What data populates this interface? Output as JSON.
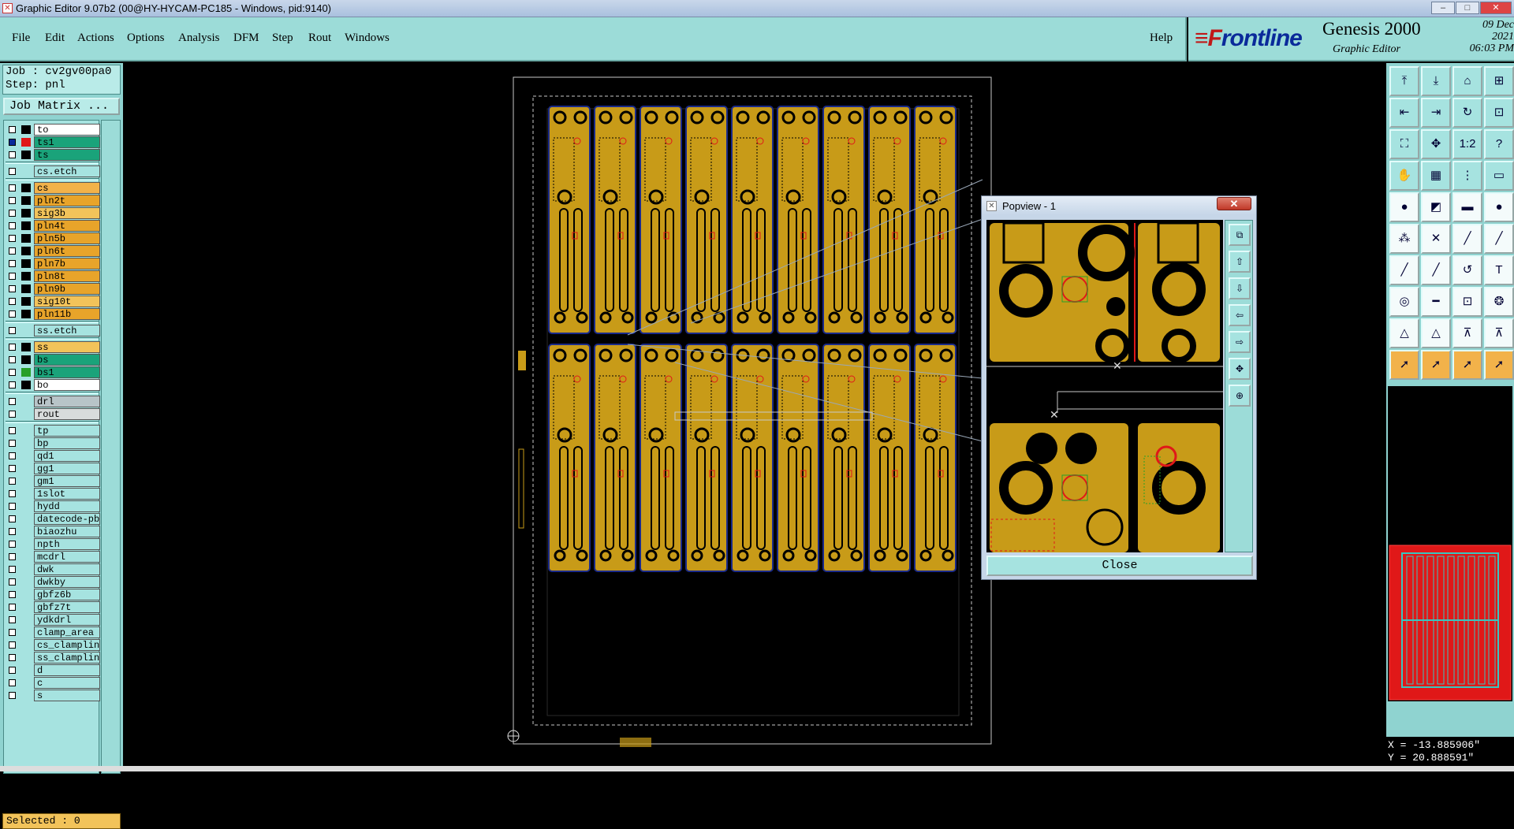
{
  "window": {
    "title": "Graphic Editor 9.07b2 (00@HY-HYCAM-PC185 - Windows, pid:9140)",
    "app_icon_glyph": "✕",
    "minimize": "–",
    "maximize": "□",
    "close": "✕"
  },
  "menu": {
    "items": [
      "File",
      "Edit",
      "Actions",
      "Options",
      "Analysis",
      "DFM",
      "Step",
      "Rout",
      "Windows"
    ],
    "help": "Help"
  },
  "brand": {
    "logo_mark": "≡F",
    "logo_text": "rontline",
    "product": "Genesis 2000",
    "subtitle": "Graphic Editor",
    "date": "09  Dec  2021",
    "time": "06:03  PM"
  },
  "job": {
    "job_label": "Job : cv2gv00pa0",
    "step_label": "Step: pnl",
    "job_matrix_button": "Job Matrix ..."
  },
  "layers": [
    {
      "name": "to",
      "color": "#ffffff",
      "swatch": "#000000",
      "active": false
    },
    {
      "name": "ts1",
      "color": "#1aa37a",
      "swatch": "#e01818",
      "active": true
    },
    {
      "name": "ts",
      "color": "#1aa37a",
      "swatch": "#000000",
      "active": false
    },
    {
      "name": "cs.etch",
      "color": "#a6e3e0",
      "swatch": "",
      "active": false,
      "group_start": true
    },
    {
      "name": "cs",
      "color": "#f2b24a",
      "swatch": "#000000",
      "active": false,
      "group_start": true
    },
    {
      "name": "pln2t",
      "color": "#e8a42a",
      "swatch": "#000000",
      "active": false
    },
    {
      "name": "sig3b",
      "color": "#f2c35a",
      "swatch": "#000000",
      "active": false
    },
    {
      "name": "pln4t",
      "color": "#e8a42a",
      "swatch": "#000000",
      "active": false
    },
    {
      "name": "pln5b",
      "color": "#e8a42a",
      "swatch": "#000000",
      "active": false
    },
    {
      "name": "pln6t",
      "color": "#e8a42a",
      "swatch": "#000000",
      "active": false
    },
    {
      "name": "pln7b",
      "color": "#e8a42a",
      "swatch": "#000000",
      "active": false
    },
    {
      "name": "pln8t",
      "color": "#e8a42a",
      "swatch": "#000000",
      "active": false
    },
    {
      "name": "pln9b",
      "color": "#e8a42a",
      "swatch": "#000000",
      "active": false
    },
    {
      "name": "sig10t",
      "color": "#f2c35a",
      "swatch": "#000000",
      "active": false
    },
    {
      "name": "pln11b",
      "color": "#e8a42a",
      "swatch": "#000000",
      "active": false
    },
    {
      "name": "ss.etch",
      "color": "#a6e3e0",
      "swatch": "",
      "active": false,
      "group_start": true
    },
    {
      "name": "ss",
      "color": "#f2c35a",
      "swatch": "#000000",
      "active": false,
      "group_start": true
    },
    {
      "name": "bs",
      "color": "#1aa37a",
      "swatch": "#000000",
      "active": false
    },
    {
      "name": "bs1",
      "color": "#1aa37a",
      "swatch": "#28a028",
      "active": false
    },
    {
      "name": "bo",
      "color": "#ffffff",
      "swatch": "#000000",
      "active": false
    },
    {
      "name": "drl",
      "color": "#b8c4c8",
      "swatch": "",
      "active": false,
      "group_start": true
    },
    {
      "name": "rout",
      "color": "#d8dcdc",
      "swatch": "",
      "active": false
    },
    {
      "name": "tp",
      "color": "#a6e3e0",
      "swatch": "",
      "active": false,
      "group_start": true
    },
    {
      "name": "bp",
      "color": "#a6e3e0",
      "swatch": "",
      "active": false
    },
    {
      "name": "qd1",
      "color": "#a6e3e0",
      "swatch": "",
      "active": false
    },
    {
      "name": "gg1",
      "color": "#a6e3e0",
      "swatch": "",
      "active": false
    },
    {
      "name": "gm1",
      "color": "#a6e3e0",
      "swatch": "",
      "active": false
    },
    {
      "name": "1slot",
      "color": "#a6e3e0",
      "swatch": "",
      "active": false
    },
    {
      "name": "hydd",
      "color": "#a6e3e0",
      "swatch": "",
      "active": false
    },
    {
      "name": "datecode-pbc",
      "color": "#a6e3e0",
      "swatch": "",
      "active": false
    },
    {
      "name": "biaozhu",
      "color": "#a6e3e0",
      "swatch": "",
      "active": false
    },
    {
      "name": "npth",
      "color": "#a6e3e0",
      "swatch": "",
      "active": false
    },
    {
      "name": "mcdrl",
      "color": "#a6e3e0",
      "swatch": "",
      "active": false
    },
    {
      "name": "dwk",
      "color": "#a6e3e0",
      "swatch": "",
      "active": false
    },
    {
      "name": "dwkby",
      "color": "#a6e3e0",
      "swatch": "",
      "active": false
    },
    {
      "name": "gbfz6b",
      "color": "#a6e3e0",
      "swatch": "",
      "active": false
    },
    {
      "name": "gbfz7t",
      "color": "#a6e3e0",
      "swatch": "",
      "active": false
    },
    {
      "name": "ydkdrl",
      "color": "#a6e3e0",
      "swatch": "",
      "active": false
    },
    {
      "name": "clamp_area",
      "color": "#a6e3e0",
      "swatch": "",
      "active": false
    },
    {
      "name": "cs_clampline",
      "color": "#a6e3e0",
      "swatch": "",
      "active": false
    },
    {
      "name": "ss_clampline",
      "color": "#a6e3e0",
      "swatch": "",
      "active": false
    },
    {
      "name": "d",
      "color": "#a6e3e0",
      "swatch": "",
      "active": false
    },
    {
      "name": "c",
      "color": "#a6e3e0",
      "swatch": "",
      "active": false
    },
    {
      "name": "s",
      "color": "#a6e3e0",
      "swatch": "",
      "active": false
    }
  ],
  "status": {
    "selected": "Selected : 0"
  },
  "popview": {
    "title": "Popview - 1",
    "close_glyph": "✕",
    "close_button": "Close",
    "tool_icons": [
      "zoom-window-icon",
      "zoom-in-icon",
      "zoom-out-icon",
      "pan-left-icon",
      "pan-right-icon",
      "fit-icon",
      "center-icon"
    ]
  },
  "toolbox": {
    "icons": [
      "home-up-icon",
      "home-down-icon",
      "home-icon",
      "grid-icon",
      "pan-left-icon",
      "pan-right-icon",
      "redraw-icon",
      "snap-icon",
      "zoom-fit-icon",
      "zoom-center-icon",
      "ratio-icon",
      "help-icon",
      "hand-icon",
      "layer-grid-icon",
      "align-icon",
      "measure-icon",
      "pad-icon",
      "profile-icon",
      "ruler-icon",
      "dot-icon",
      "select-net-icon",
      "cross-icon",
      "line-red-icon",
      "line-blue-icon",
      "line-draw-icon",
      "line-cut-icon",
      "arc-icon",
      "text-icon",
      "pad-add-icon",
      "line-add-icon",
      "region-icon",
      "circles-icon",
      "triangle-a-icon",
      "triangle-b-icon",
      "shape-c-icon",
      "shape-d-icon",
      "pointer-icon",
      "pointer-select-icon",
      "pointer-move-icon",
      "pointer-edit-icon"
    ],
    "ratio_label": "1:2",
    "help_label": "?"
  },
  "coords": {
    "x": "X = -13.885906\"",
    "y": "Y = 20.888591\""
  },
  "colors": {
    "panel": "#8fd3d0",
    "copper": "#c89b18",
    "board_red": "#e01818",
    "brand_blue": "#0a2a9a"
  }
}
